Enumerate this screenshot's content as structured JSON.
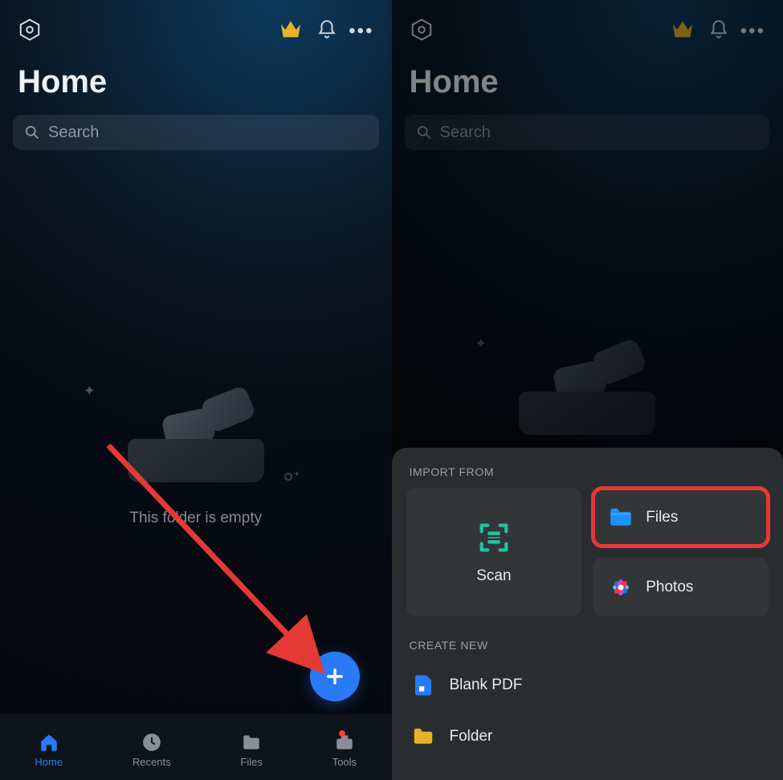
{
  "left": {
    "page_title": "Home",
    "search_placeholder": "Search",
    "empty_text": "This folder is empty",
    "tabs": {
      "home": "Home",
      "recents": "Recents",
      "files": "Files",
      "tools": "Tools"
    }
  },
  "right": {
    "page_title": "Home",
    "search_placeholder": "Search",
    "sheet": {
      "import_from_label": "IMPORT FROM",
      "scan_label": "Scan",
      "files_label": "Files",
      "photos_label": "Photos",
      "create_new_label": "CREATE NEW",
      "blank_pdf_label": "Blank PDF",
      "folder_label": "Folder"
    }
  }
}
